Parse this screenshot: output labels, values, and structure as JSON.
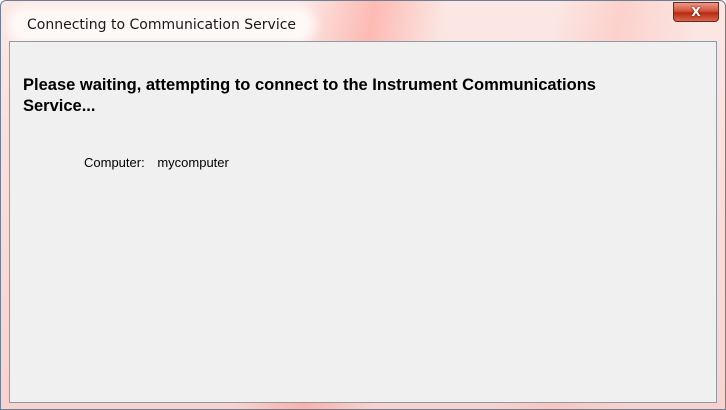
{
  "window": {
    "title": "Connecting to Communication Service",
    "close_label": "X"
  },
  "dialog": {
    "message": "Please waiting, attempting to connect to the Instrument Communications Service...",
    "computer_label": "Computer:",
    "computer_value": "mycomputer"
  },
  "colors": {
    "titlebar_tint": "#f7d3cf",
    "close_button": "#c7432b",
    "client_background": "#f0f0f0"
  }
}
